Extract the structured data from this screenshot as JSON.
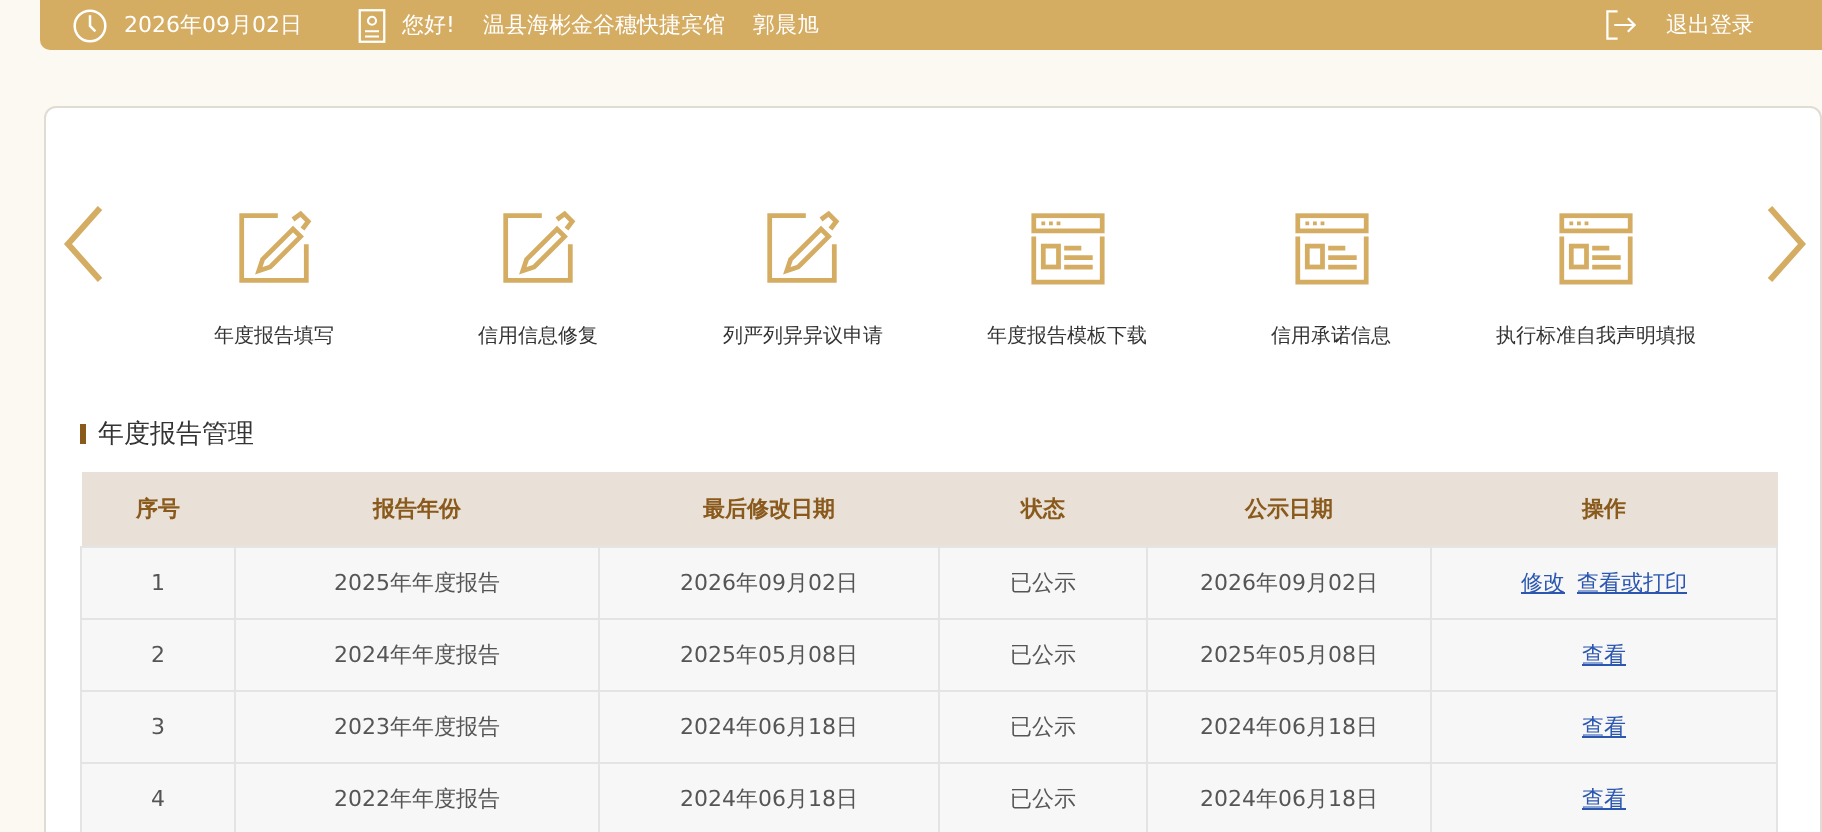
{
  "top_bar": {
    "date": "2026年09月02日",
    "greeting": "您好!",
    "company": "温县海彬金谷穗快捷宾馆",
    "user": "郭晨旭",
    "logout": "退出登录"
  },
  "shortcuts": [
    {
      "label": "年度报告填写",
      "kind": "pencil"
    },
    {
      "label": "信用信息修复",
      "kind": "pencil"
    },
    {
      "label": "列严列异异议申请",
      "kind": "pencil"
    },
    {
      "label": "年度报告模板下载",
      "kind": "form"
    },
    {
      "label": "信用承诺信息",
      "kind": "form"
    },
    {
      "label": "执行标准自我声明填报",
      "kind": "form"
    }
  ],
  "section_title": "年度报告管理",
  "table": {
    "columns": [
      "序号",
      "报告年份",
      "最后修改日期",
      "状态",
      "公示日期",
      "操作"
    ],
    "rows": [
      {
        "cells": [
          "1",
          "2025年年度报告",
          "2026年09月02日",
          "已公示",
          "2026年09月02日"
        ],
        "actions": [
          "修改",
          "查看或打印"
        ]
      },
      {
        "cells": [
          "2",
          "2024年年度报告",
          "2025年05月08日",
          "已公示",
          "2025年05月08日"
        ],
        "actions": [
          "查看"
        ]
      },
      {
        "cells": [
          "3",
          "2023年年度报告",
          "2024年06月18日",
          "已公示",
          "2024年06月18日"
        ],
        "actions": [
          "查看"
        ]
      },
      {
        "cells": [
          "4",
          "2022年年度报告",
          "2024年06月18日",
          "已公示",
          "2024年06月18日"
        ],
        "actions": [
          "查看"
        ]
      }
    ]
  }
}
